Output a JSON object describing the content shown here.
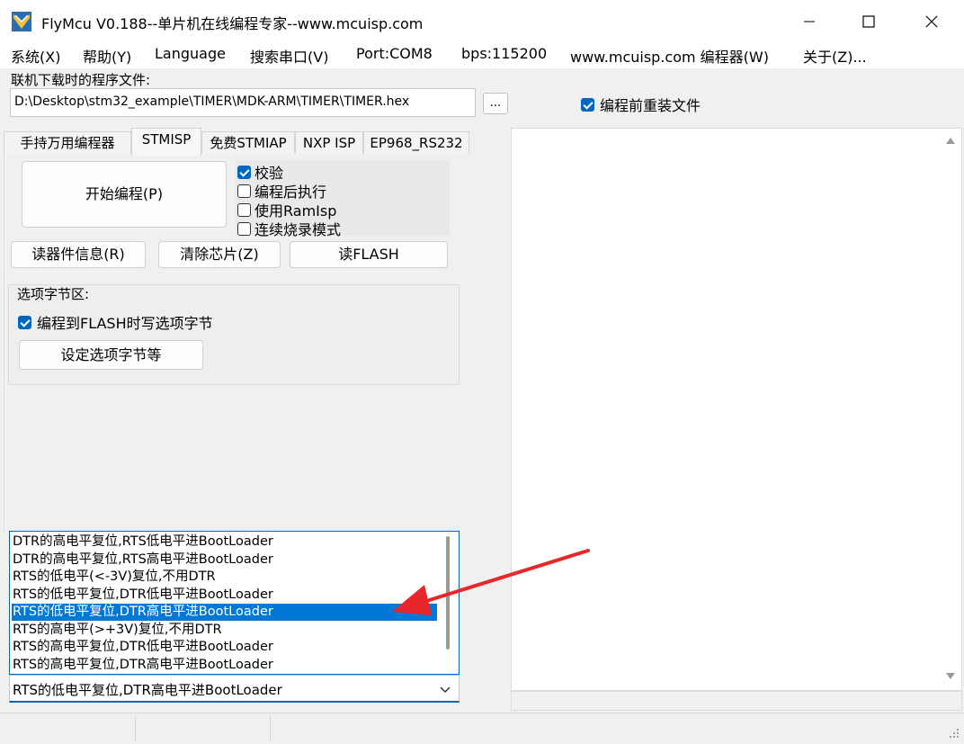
{
  "window": {
    "title": "FlyMcu V0.188--单片机在线编程专家--www.mcuisp.com",
    "minimize_glyph": "—",
    "maximize_glyph": "☐",
    "close_glyph": "✕"
  },
  "menu": {
    "items": [
      "系统(X)",
      "帮助(Y)",
      "Language",
      "搜索串口(V)",
      "Port:COM8",
      "bps:115200",
      "www.mcuisp.com 编程器(W)",
      "关于(Z)..."
    ]
  },
  "file": {
    "label": "联机下载时的程序文件:",
    "path": "D:\\Desktop\\stm32_example\\TIMER\\MDK-ARM\\TIMER\\TIMER.hex",
    "browse_label": "...",
    "reload_label": "编程前重装文件",
    "reload_checked": true
  },
  "tabs": [
    {
      "label": "手持万用编程器",
      "active": false
    },
    {
      "label": "STMISP",
      "active": true
    },
    {
      "label": "免费STMIAP",
      "active": false
    },
    {
      "label": "NXP ISP",
      "active": false
    },
    {
      "label": "EP968_RS232",
      "active": false
    }
  ],
  "stmisp": {
    "start_label": "开始编程(P)",
    "options": [
      {
        "label": "校验",
        "checked": true
      },
      {
        "label": "编程后执行",
        "checked": false
      },
      {
        "label": "使用RamIsp",
        "checked": false
      },
      {
        "label": "连续烧录模式",
        "checked": false
      }
    ],
    "read_info_label": "读器件信息(R)",
    "erase_label": "清除芯片(Z)",
    "read_flash_label": "读FLASH",
    "option_group_title": "选项字节区:",
    "option_write_label": "编程到FLASH时写选项字节",
    "option_write_checked": true,
    "option_set_label": "设定选项字节等"
  },
  "dtr_rts": {
    "items": [
      "DTR的高电平复位,RTS低电平进BootLoader",
      "DTR的高电平复位,RTS高电平进BootLoader",
      "RTS的低电平(<-3V)复位,不用DTR",
      "RTS的低电平复位,DTR低电平进BootLoader",
      "RTS的低电平复位,DTR高电平进BootLoader",
      "RTS的高电平(>+3V)复位,不用DTR",
      "RTS的高电平复位,DTR低电平进BootLoader",
      "RTS的高电平复位,DTR高电平进BootLoader"
    ],
    "selected_index": 4,
    "selected_value": "RTS的低电平复位,DTR高电平进BootLoader"
  },
  "colors": {
    "accent": "#0067c0",
    "selection": "#0078d7",
    "annotation_arrow": "#e8262b"
  }
}
